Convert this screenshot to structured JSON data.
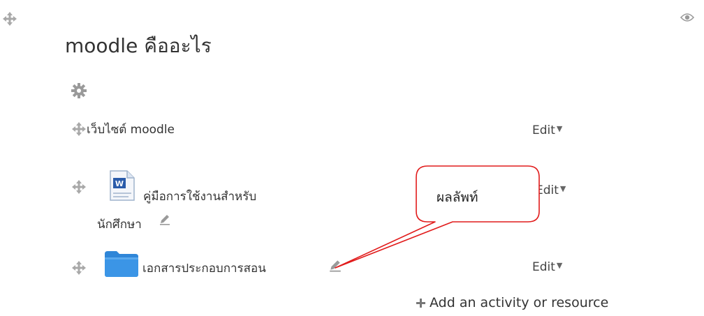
{
  "section": {
    "title": "moodle คืออะไร"
  },
  "activities": [
    {
      "label": "เว็บไซต์ moodle",
      "icon": "move-icon"
    },
    {
      "label_line1": "คู่มือการใช้งานสำหรับ",
      "label_line2": "นักศึกษา",
      "icon": "word-document-icon"
    },
    {
      "label": "เอกสารประกอบการสอน",
      "icon": "folder-icon"
    }
  ],
  "edit_menus": [
    {
      "label": "Edit"
    },
    {
      "label": "Edit"
    },
    {
      "label": "Edit"
    }
  ],
  "add_activity": {
    "label": "Add an activity or resource"
  },
  "callout": {
    "text": "ผลลัพท์"
  },
  "colors": {
    "callout_border": "#e11b1b",
    "folder": "#2f86d8",
    "icon_grey": "#9a9a9a"
  }
}
